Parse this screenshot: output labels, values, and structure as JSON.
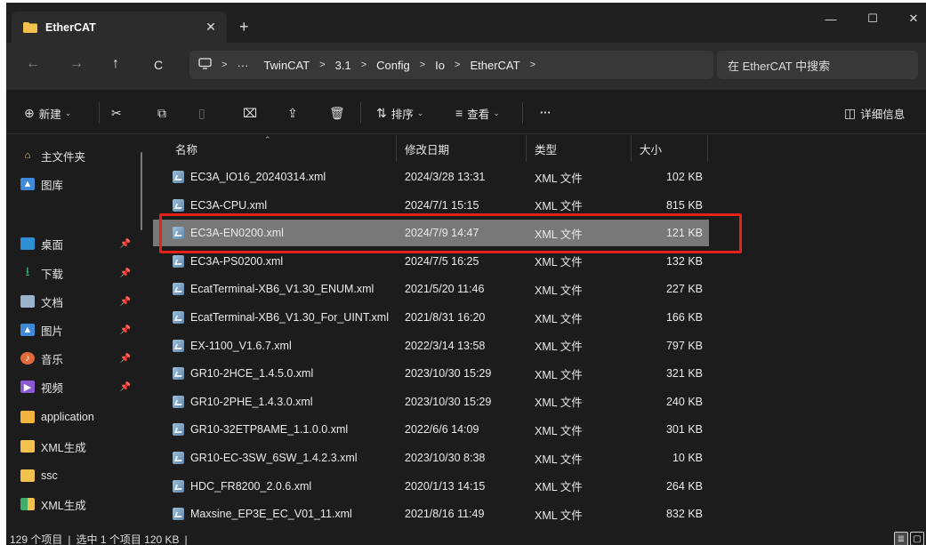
{
  "tab": {
    "title": "EtherCAT",
    "close": "✕",
    "new": "+"
  },
  "window_controls": {
    "minimize": "—",
    "maximize": "☐",
    "close": "✕"
  },
  "nav": {
    "back": "←",
    "forward": "→",
    "up": "↑",
    "refresh": "C"
  },
  "address": {
    "more": "···",
    "crumbs": [
      "TwinCAT",
      "3.1",
      "Config",
      "Io",
      "EtherCAT"
    ],
    "separator": ">"
  },
  "search": {
    "placeholder": "在 EtherCAT 中搜索"
  },
  "toolbar": {
    "new_label": "新建",
    "sort_label": "排序",
    "view_label": "查看",
    "more": "···",
    "details_label": "详细信息"
  },
  "sidebar": {
    "items": [
      {
        "label": "主文件夹",
        "icon": "home-icon",
        "pinned": false
      },
      {
        "label": "图库",
        "icon": "gallery-icon",
        "pinned": false
      },
      {
        "label": "桌面",
        "icon": "desktop-icon",
        "pinned": true
      },
      {
        "label": "下载",
        "icon": "download-icon",
        "pinned": true
      },
      {
        "label": "文档",
        "icon": "document-icon",
        "pinned": true
      },
      {
        "label": "图片",
        "icon": "pictures-icon",
        "pinned": true
      },
      {
        "label": "音乐",
        "icon": "music-icon",
        "pinned": true
      },
      {
        "label": "视频",
        "icon": "video-icon",
        "pinned": true
      },
      {
        "label": "application",
        "icon": "folder-icon",
        "pinned": false
      },
      {
        "label": "XML生成",
        "icon": "folder-icon",
        "pinned": false
      },
      {
        "label": "ssc",
        "icon": "folder-icon",
        "pinned": false
      },
      {
        "label": "XML生成",
        "icon": "folder-green-icon",
        "pinned": false
      }
    ]
  },
  "columns": {
    "name": "名称",
    "date": "修改日期",
    "type": "类型",
    "size": "大小"
  },
  "files": [
    {
      "name": "EC3A_IO16_20240314.xml",
      "date": "2024/3/28 13:31",
      "type": "XML 文件",
      "size": "102 KB",
      "selected": false
    },
    {
      "name": "EC3A-CPU.xml",
      "date": "2024/7/1 15:15",
      "type": "XML 文件",
      "size": "815 KB",
      "selected": false
    },
    {
      "name": "EC3A-EN0200.xml",
      "date": "2024/7/9 14:47",
      "type": "XML 文件",
      "size": "121 KB",
      "selected": true
    },
    {
      "name": "EC3A-PS0200.xml",
      "date": "2024/7/5 16:25",
      "type": "XML 文件",
      "size": "132 KB",
      "selected": false
    },
    {
      "name": "EcatTerminal-XB6_V1.30_ENUM.xml",
      "date": "2021/5/20 11:46",
      "type": "XML 文件",
      "size": "227 KB",
      "selected": false
    },
    {
      "name": "EcatTerminal-XB6_V1.30_For_UINT.xml",
      "date": "2021/8/31 16:20",
      "type": "XML 文件",
      "size": "166 KB",
      "selected": false
    },
    {
      "name": "EX-1100_V1.6.7.xml",
      "date": "2022/3/14 13:58",
      "type": "XML 文件",
      "size": "797 KB",
      "selected": false
    },
    {
      "name": "GR10-2HCE_1.4.5.0.xml",
      "date": "2023/10/30 15:29",
      "type": "XML 文件",
      "size": "321 KB",
      "selected": false
    },
    {
      "name": "GR10-2PHE_1.4.3.0.xml",
      "date": "2023/10/30 15:29",
      "type": "XML 文件",
      "size": "240 KB",
      "selected": false
    },
    {
      "name": "GR10-32ETP8AME_1.1.0.0.xml",
      "date": "2022/6/6 14:09",
      "type": "XML 文件",
      "size": "301 KB",
      "selected": false
    },
    {
      "name": "GR10-EC-3SW_6SW_1.4.2.3.xml",
      "date": "2023/10/30 8:38",
      "type": "XML 文件",
      "size": "10 KB",
      "selected": false
    },
    {
      "name": "HDC_FR8200_2.0.6.xml",
      "date": "2020/1/13 14:15",
      "type": "XML 文件",
      "size": "264 KB",
      "selected": false
    },
    {
      "name": "Maxsine_EP3E_EC_V01_11.xml",
      "date": "2021/8/16 11:49",
      "type": "XML 文件",
      "size": "832 KB",
      "selected": false
    }
  ],
  "status": {
    "count": "129 个项目",
    "divider": "|",
    "selection": "选中 1 个项目 120 KB"
  },
  "colors": {
    "window_bg": "#1c1c1c",
    "selected_row": "#787878",
    "highlight_border": "#e52219"
  }
}
